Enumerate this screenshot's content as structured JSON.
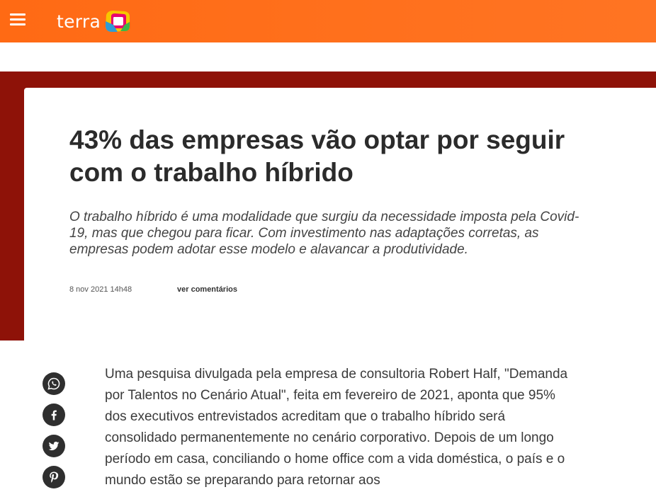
{
  "header": {
    "logo_text": "terra",
    "brand_color": "#ff6b17",
    "icons": [
      "hamburger-menu-icon",
      "terra-logo-icon"
    ]
  },
  "hero": {
    "accent_color": "#8e1208"
  },
  "article": {
    "headline": "43% das empresas vão optar por seguir com o trabalho híbrido",
    "subheadline": "O trabalho híbrido é uma modalidade que surgiu da necessidade imposta pela Covid-19, mas que chegou para ficar. Com investimento nas adaptações corretas, as empresas podem adotar esse modelo e alavancar a produtividade.",
    "date": "8 nov 2021 14h48",
    "comments_link": "ver comentários",
    "body": "Uma pesquisa divulgada pela empresa de consultoria Robert Half, \"Demanda por Talentos no Cenário Atual\", feita em fevereiro de 2021, aponta que 95% dos executivos entrevistados acreditam que o trabalho híbrido será consolidado permanentemente no cenário corporativo. Depois de um longo período em casa, conciliando o home office com a vida doméstica, o país e o mundo estão se preparando para retornar aos"
  },
  "share": {
    "icons": [
      "whatsapp-icon",
      "facebook-icon",
      "twitter-icon",
      "pinterest-icon"
    ]
  }
}
